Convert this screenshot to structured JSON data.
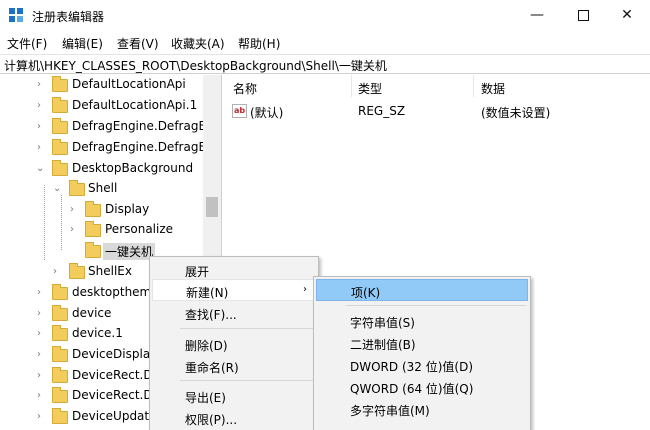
{
  "window": {
    "title": "注册表编辑器"
  },
  "menubar": {
    "file": "文件(F)",
    "edit": "编辑(E)",
    "view": "查看(V)",
    "favorites": "收藏夹(A)",
    "help": "帮助(H)"
  },
  "address": "计算机\\HKEY_CLASSES_ROOT\\DesktopBackground\\Shell\\一键关机",
  "tree": {
    "items": [
      {
        "label": "DefaultLocationApi"
      },
      {
        "label": "DefaultLocationApi.1"
      },
      {
        "label": "DefragEngine.DefragE"
      },
      {
        "label": "DefragEngine.DefragE"
      },
      {
        "label": "DesktopBackground"
      },
      {
        "label": "Shell"
      },
      {
        "label": "Display"
      },
      {
        "label": "Personalize"
      },
      {
        "label": "一键关机"
      },
      {
        "label": "ShellEx"
      },
      {
        "label": "desktopthem"
      },
      {
        "label": "device"
      },
      {
        "label": "device.1"
      },
      {
        "label": "DeviceDispla"
      },
      {
        "label": "DeviceRect.D"
      },
      {
        "label": "DeviceRect.D"
      },
      {
        "label": "DeviceUpdat"
      }
    ]
  },
  "list": {
    "headers": {
      "name": "名称",
      "type": "类型",
      "data": "数据"
    },
    "rows": [
      {
        "name": "(默认)",
        "type": "REG_SZ",
        "data": "(数值未设置)"
      }
    ]
  },
  "context_menu": {
    "items": [
      {
        "label": "展开"
      },
      {
        "label": "新建(N)"
      },
      {
        "label": "查找(F)..."
      },
      {
        "label": "删除(D)"
      },
      {
        "label": "重命名(R)"
      },
      {
        "label": "导出(E)"
      },
      {
        "label": "权限(P)..."
      }
    ]
  },
  "submenu": {
    "items": [
      {
        "label": "项(K)"
      },
      {
        "label": "字符串值(S)"
      },
      {
        "label": "二进制值(B)"
      },
      {
        "label": "DWORD (32 位)值(D)"
      },
      {
        "label": "QWORD (64 位)值(Q)"
      },
      {
        "label": "多字符串值(M)"
      }
    ]
  },
  "colors": {
    "accent": "#1a73c9",
    "folder": "#f3cd5c",
    "submenu_highlight": "#91c9f7"
  }
}
